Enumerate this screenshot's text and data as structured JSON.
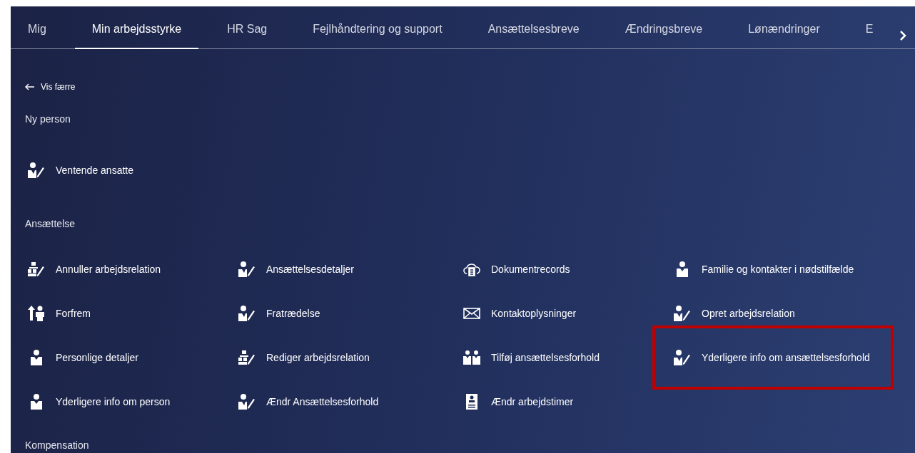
{
  "tabs": [
    {
      "label": "Mig",
      "selected": false
    },
    {
      "label": "Min arbejdsstyrke",
      "selected": true
    },
    {
      "label": "HR Sag",
      "selected": false
    },
    {
      "label": "Fejlhåndtering og support",
      "selected": false
    },
    {
      "label": "Ansættelsesbreve",
      "selected": false
    },
    {
      "label": "Ændringsbreve",
      "selected": false
    },
    {
      "label": "Lønændringer",
      "selected": false
    },
    {
      "label": "E",
      "selected": false
    }
  ],
  "back_link": "Vis færre",
  "sections": [
    {
      "title": "Ny person",
      "items": [
        {
          "label": "Ventende ansatte",
          "kind": "person-edit",
          "highlighted": false
        }
      ]
    },
    {
      "title": "Ansættelse",
      "items": [
        {
          "label": "Annuller arbejdsrelation",
          "kind": "org-edit",
          "highlighted": false
        },
        {
          "label": "Ansættelsesdetaljer",
          "kind": "person-edit",
          "highlighted": false
        },
        {
          "label": "Dokumentrecords",
          "kind": "cloud-doc",
          "highlighted": false
        },
        {
          "label": "Familie og kontakter i nødstilfælde",
          "kind": "person",
          "highlighted": false
        },
        {
          "label": "Forfrem",
          "kind": "promote",
          "highlighted": false
        },
        {
          "label": "Fratrædelse",
          "kind": "person-edit",
          "highlighted": false
        },
        {
          "label": "Kontaktoplysninger",
          "kind": "mail",
          "highlighted": false
        },
        {
          "label": "Opret arbejdsrelation",
          "kind": "person-edit",
          "highlighted": false
        },
        {
          "label": "Personlige detaljer",
          "kind": "person",
          "highlighted": false
        },
        {
          "label": "Rediger arbejdsrelation",
          "kind": "org-edit",
          "highlighted": false
        },
        {
          "label": "Tilføj ansættelsesforhold",
          "kind": "people-check",
          "highlighted": false
        },
        {
          "label": "Yderligere info om ansættelsesforhold",
          "kind": "person-edit",
          "highlighted": true
        },
        {
          "label": "Yderligere info om person",
          "kind": "person",
          "highlighted": false
        },
        {
          "label": "Ændr Ansættelsesforhold",
          "kind": "person-edit",
          "highlighted": false
        },
        {
          "label": "Ændr arbejdstimer",
          "kind": "id-card",
          "highlighted": false
        }
      ]
    },
    {
      "title": "Kompensation"
    }
  ]
}
